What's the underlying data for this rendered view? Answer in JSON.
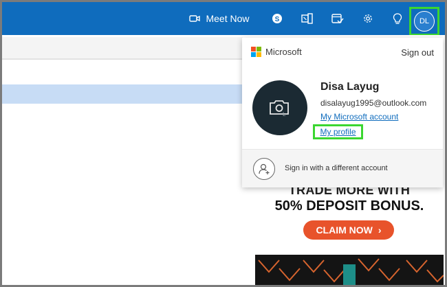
{
  "topbar": {
    "meet_now_label": "Meet Now",
    "user_initials": "DL",
    "bg_color": "#0f6cbd"
  },
  "flyout": {
    "brand": "Microsoft",
    "sign_out": "Sign out",
    "name": "Disa Layug",
    "email": "disalayug1995@outlook.com",
    "my_account": "My Microsoft account",
    "my_profile": "My profile",
    "alt_sign_in": "Sign in with a different account"
  },
  "ad": {
    "headline": "TRADE MORE WITH",
    "subheadline": "50% DEPOSIT BONUS.",
    "cta": "CLAIM NOW",
    "cta_color": "#e8532b"
  },
  "highlight_color": "#3bd630"
}
